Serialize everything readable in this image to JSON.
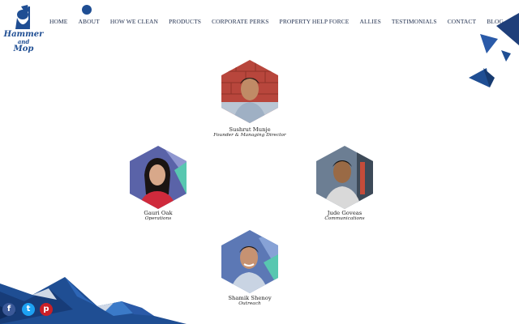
{
  "brand": {
    "logo_line1": "Hammer",
    "logo_line2": "and",
    "logo_line3": "Mop"
  },
  "nav": {
    "items": [
      "HOME",
      "ABOUT",
      "HOW WE CLEAN",
      "PRODUCTS",
      "CORPORATE PERKS",
      "PROPERTY HELP FORCE",
      "ALLIES",
      "TESTIMONIALS",
      "CONTACT",
      "BLOG"
    ]
  },
  "team": [
    {
      "name": "Sushrut Munje",
      "role": "Founder & Managing Director",
      "photo_bg": "#b8463c"
    },
    {
      "name": "Gauri Oak",
      "role": "Operations",
      "photo_bg": "#5a63a8"
    },
    {
      "name": "Jude Goveas",
      "role": "Communications",
      "photo_bg": "#6c7e93"
    },
    {
      "name": "Shamik Shenoy",
      "role": "Outreach",
      "photo_bg": "#5c78b5"
    }
  ],
  "social": {
    "facebook": {
      "icon": "facebook-icon",
      "glyph": "f",
      "color": "#3b5998"
    },
    "twitter": {
      "icon": "twitter-icon",
      "glyph": "t",
      "color": "#1da1f2"
    },
    "pinterest": {
      "icon": "pinterest-icon",
      "glyph": "p",
      "color": "#cb2027"
    }
  },
  "colors": {
    "brand_blue": "#1f4e93",
    "navy": "#1b2a4a"
  }
}
